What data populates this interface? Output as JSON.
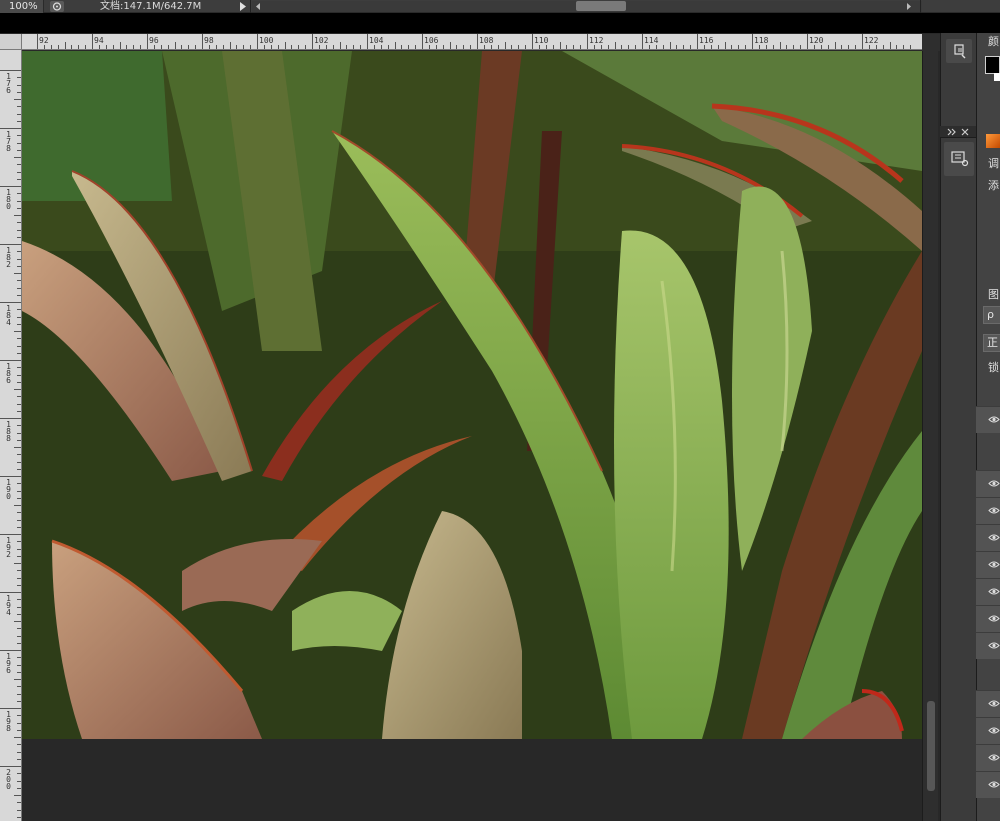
{
  "status_bar": {
    "zoom": "100%",
    "doc_info": "文档:147.1M/642.7M"
  },
  "ruler": {
    "top_labels": [
      "92",
      "94",
      "96",
      "98",
      "100",
      "102",
      "104",
      "106",
      "108",
      "110",
      "112",
      "114",
      "116",
      "118",
      "120",
      "122"
    ],
    "left_labels": [
      "176",
      "178",
      "180",
      "182",
      "184",
      "186",
      "188",
      "190",
      "192",
      "194",
      "196",
      "198",
      "200"
    ]
  },
  "right_panel": {
    "partial_labels": [
      "颜",
      "调",
      "添",
      "图",
      "正",
      "锁"
    ],
    "search_button": "ρ",
    "foreground_color": "#000000",
    "background_color": "#ffffff"
  },
  "canvas": {
    "image_subject": "photo-of-leaves"
  },
  "colors": {
    "ruler_bg": "#d8d8d8",
    "workspace_bg": "#282828",
    "panel_bg": "#3b3b3b"
  }
}
